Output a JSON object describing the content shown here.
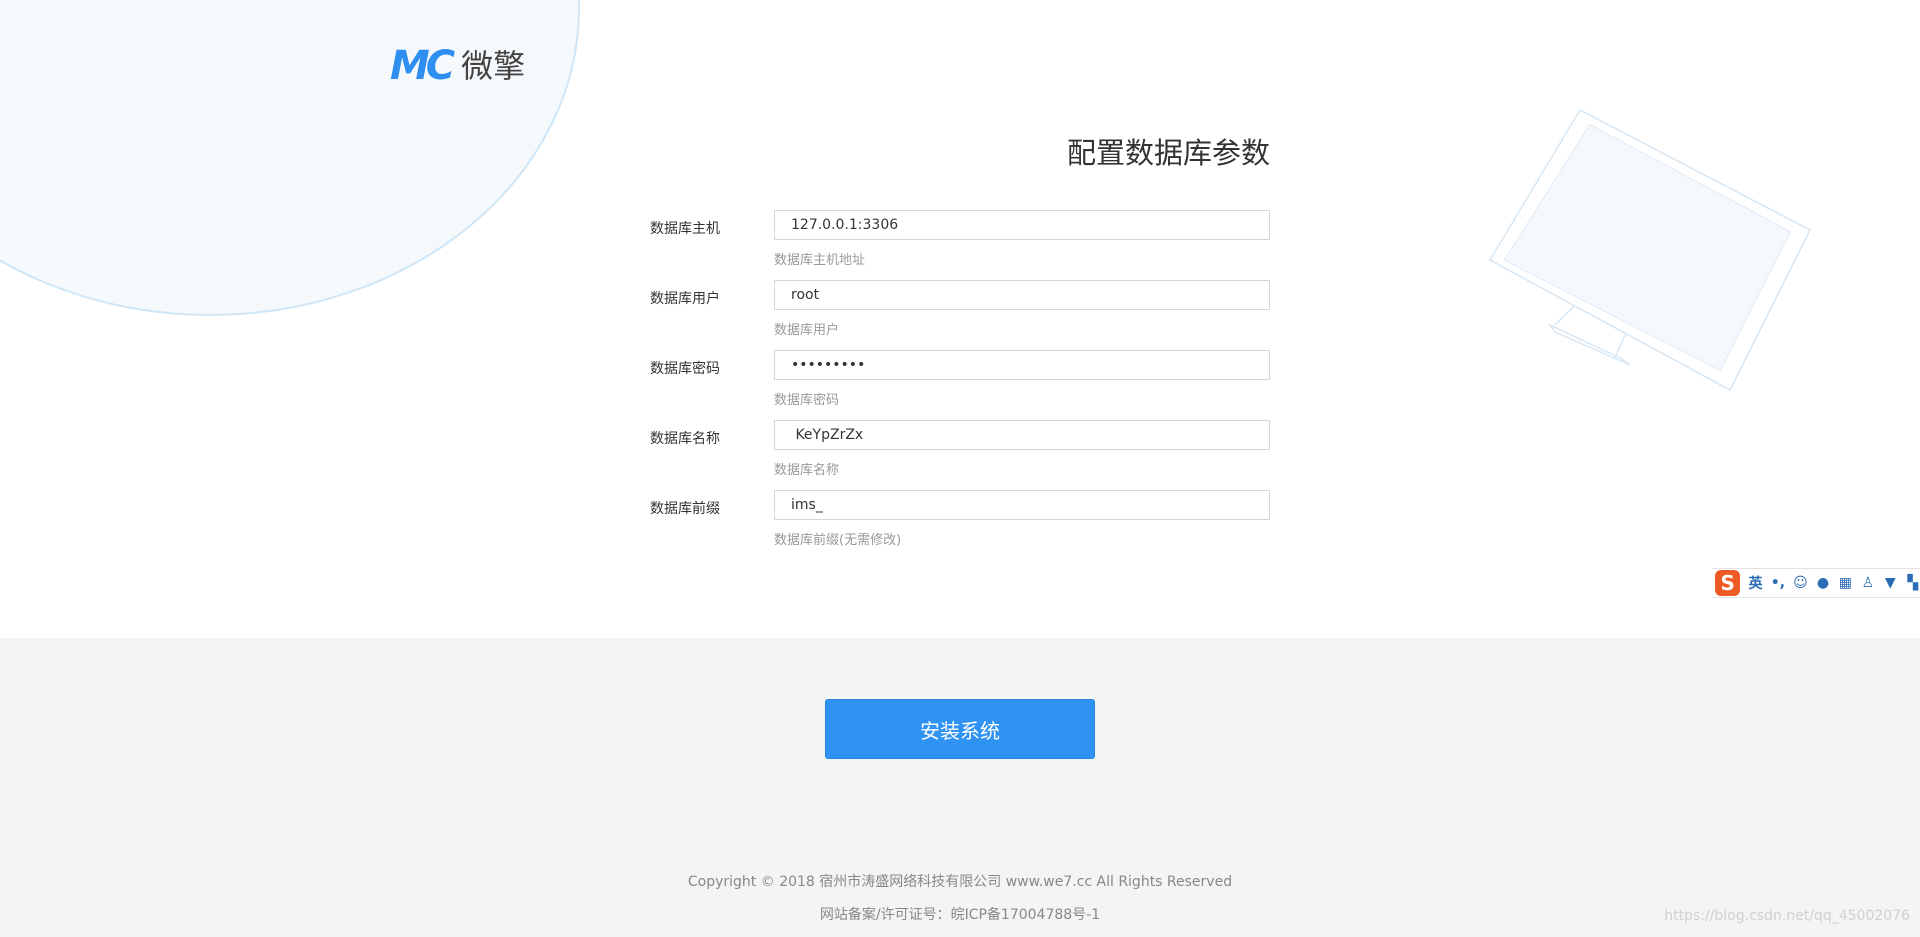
{
  "brand": {
    "logo_mark": "MC",
    "logo_text": "微擎"
  },
  "page": {
    "title": "配置数据库参数"
  },
  "form": {
    "fields": [
      {
        "label": "数据库主机",
        "value": "127.0.0.1:3306",
        "help": "数据库主机地址"
      },
      {
        "label": "数据库用户",
        "value": "root",
        "help": "数据库用户"
      },
      {
        "label": "数据库密码",
        "value": "•••••••••",
        "help": "数据库密码"
      },
      {
        "label": "数据库名称",
        "value": " KeYpZrZx",
        "help": "数据库名称"
      },
      {
        "label": "数据库前缀",
        "value": "ims_",
        "help": "数据库前缀(无需修改)"
      }
    ]
  },
  "ime": {
    "logo": "S",
    "lang": "英",
    "punct": "•,"
  },
  "actions": {
    "install_label": "安装系统"
  },
  "footer": {
    "copyright": "Copyright © 2018 宿州市涛盛网络科技有限公司 www.we7.cc All Rights Reserved",
    "icp": "网站备案/许可证号：皖ICP备17004788号-1",
    "watermark": "https://blog.csdn.net/qq_45002076"
  },
  "colors": {
    "accent": "#2f93f4",
    "ime_logo": "#ee5a24",
    "bottom_bg": "#f4f4f4"
  }
}
